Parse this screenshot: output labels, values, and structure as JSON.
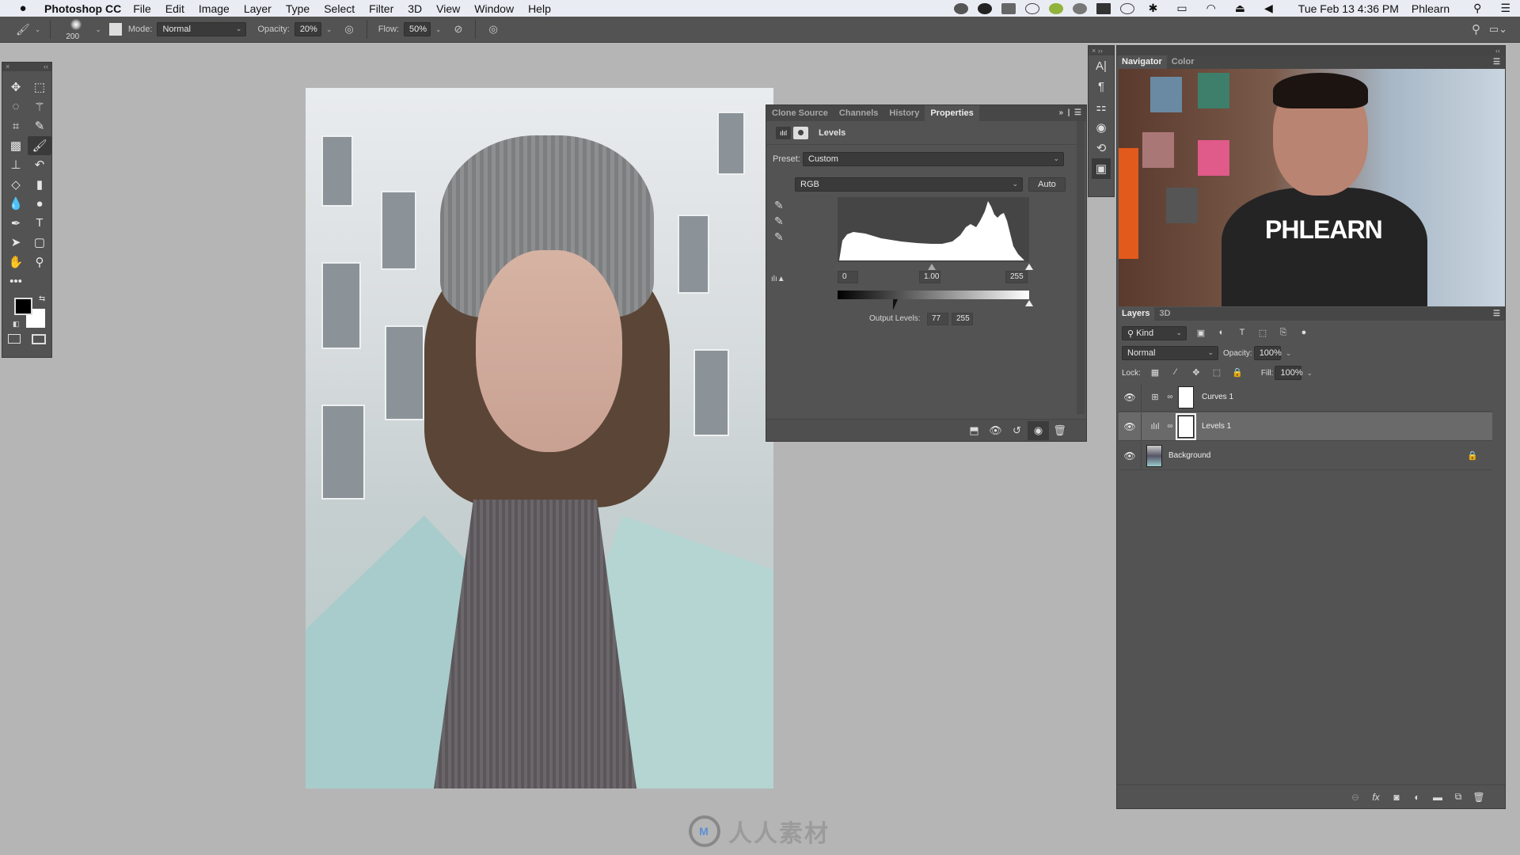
{
  "menubar": {
    "apple_icon": "apple-icon",
    "app_name": "Photoshop CC",
    "menus": [
      "File",
      "Edit",
      "Image",
      "Layer",
      "Type",
      "Select",
      "Filter",
      "3D",
      "View",
      "Window",
      "Help"
    ],
    "tray_icons": [
      "creative-cloud-icon",
      "vpn-icon",
      "screen-icon",
      "clock-icon",
      "s-app-icon",
      "drive-icon",
      "grid-icon",
      "time-machine-icon",
      "bluetooth-icon",
      "airplay-icon",
      "wifi-icon",
      "eject-icon",
      "volume-icon"
    ],
    "datetime": "Tue Feb 13  4:36 PM",
    "user": "Phlearn",
    "search_icon": "spotlight-icon",
    "list_icon": "notification-center-icon"
  },
  "options_bar": {
    "tool_icon": "brush-icon",
    "brush_size": "200",
    "mode_label": "Mode:",
    "mode_value": "Normal",
    "opacity_label": "Opacity:",
    "opacity_value": "20%",
    "flow_label": "Flow:",
    "flow_value": "50%"
  },
  "tools": {
    "items": [
      {
        "name": "move-tool",
        "glyph": "✥"
      },
      {
        "name": "marquee-tool",
        "glyph": "⬚"
      },
      {
        "name": "lasso-tool",
        "glyph": "◌"
      },
      {
        "name": "magic-wand-tool",
        "glyph": "⚚"
      },
      {
        "name": "crop-tool",
        "glyph": "⌗"
      },
      {
        "name": "eyedropper-tool",
        "glyph": "✎"
      },
      {
        "name": "healing-brush-tool",
        "glyph": "▩"
      },
      {
        "name": "brush-tool",
        "glyph": "🖌"
      },
      {
        "name": "clone-stamp-tool",
        "glyph": "⊥"
      },
      {
        "name": "history-brush-tool",
        "glyph": "↶"
      },
      {
        "name": "eraser-tool",
        "glyph": "◇"
      },
      {
        "name": "gradient-tool",
        "glyph": "▮"
      },
      {
        "name": "blur-tool",
        "glyph": "💧"
      },
      {
        "name": "dodge-tool",
        "glyph": "●"
      },
      {
        "name": "pen-tool",
        "glyph": "✒"
      },
      {
        "name": "type-tool",
        "glyph": "T"
      },
      {
        "name": "path-selection-tool",
        "glyph": "➤"
      },
      {
        "name": "shape-tool",
        "glyph": "▢"
      },
      {
        "name": "hand-tool",
        "glyph": "✋"
      },
      {
        "name": "zoom-tool",
        "glyph": "⚲"
      },
      {
        "name": "more-tools",
        "glyph": "•••"
      },
      {
        "name": "blank",
        "glyph": ""
      }
    ]
  },
  "properties": {
    "tabs": [
      "Clone Source",
      "Channels",
      "History",
      "Properties"
    ],
    "active_tab": "Properties",
    "adjustment_name": "Levels",
    "preset_label": "Preset:",
    "preset_value": "Custom",
    "channel_value": "RGB",
    "auto_label": "Auto",
    "input_black": "0",
    "input_gamma": "1.00",
    "input_white": "255",
    "output_label": "Output Levels:",
    "output_black": "77",
    "output_white": "255",
    "footer_icons": [
      "clip-to-layer-icon",
      "view-previous-icon",
      "reset-icon",
      "visibility-icon",
      "delete-icon"
    ]
  },
  "dock": {
    "icons": [
      {
        "name": "character-icon",
        "glyph": "A|"
      },
      {
        "name": "paragraph-icon",
        "glyph": "¶"
      },
      {
        "name": "clone-source-icon",
        "glyph": "⚏"
      },
      {
        "name": "channels-icon",
        "glyph": "◉"
      },
      {
        "name": "history-icon",
        "glyph": "⟲"
      },
      {
        "name": "properties-icon",
        "glyph": "▣"
      }
    ]
  },
  "navigator": {
    "tabs": [
      "Navigator",
      "Color"
    ],
    "active_tab": "Navigator",
    "preview_text": "PHLEARN"
  },
  "layers": {
    "tabs": [
      "Layers",
      "3D"
    ],
    "active_tab": "Layers",
    "filter_label": "Kind",
    "blend_mode": "Normal",
    "opacity_label": "Opacity:",
    "opacity_value": "100%",
    "lock_label": "Lock:",
    "fill_label": "Fill:",
    "fill_value": "100%",
    "items": [
      {
        "name": "Curves 1",
        "type": "curves",
        "visible": true,
        "selected": false
      },
      {
        "name": "Levels 1",
        "type": "levels",
        "visible": true,
        "selected": true
      },
      {
        "name": "Background",
        "type": "image",
        "visible": true,
        "selected": false,
        "locked": true
      }
    ],
    "footer_icons": [
      "link-layers-icon",
      "fx-icon",
      "add-mask-icon",
      "adjustment-layer-icon",
      "group-icon",
      "new-layer-icon",
      "delete-layer-icon"
    ]
  },
  "watermark": {
    "text": "人人素材"
  }
}
